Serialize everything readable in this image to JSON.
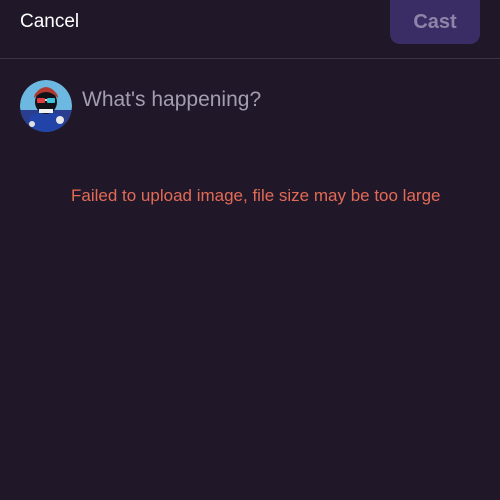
{
  "header": {
    "cancel_label": "Cancel",
    "cast_label": "Cast"
  },
  "composer": {
    "placeholder": "What's happening?",
    "value": ""
  },
  "error": {
    "message": "Failed to upload image, file size may be too large"
  },
  "colors": {
    "background": "#201829",
    "accent_button": "#3a2d66",
    "error": "#e36a55"
  }
}
